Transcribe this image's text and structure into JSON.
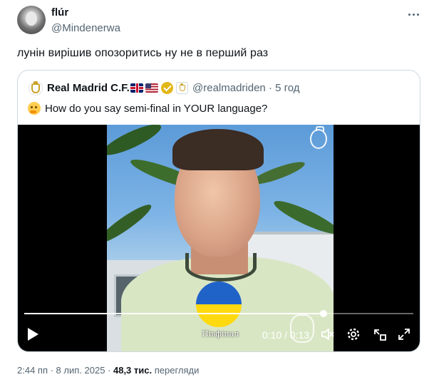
{
  "author": {
    "name": "flúr",
    "handle": "@Mindenerwa"
  },
  "tweet": {
    "text": "лунін вирішив опозоритись ну не в перший раз"
  },
  "quote": {
    "name": "Real Madrid C.F.",
    "handle": "@realmadriden · 5 год",
    "text": "How do you say semi-final in YOUR language?",
    "flags": [
      "uk-flag",
      "us-flag"
    ],
    "verified_color": "#e2b719"
  },
  "video": {
    "sticker_text": "Півфінал",
    "time": "0:10 / 0:13",
    "progress": 0.77,
    "controls": [
      "play",
      "volume",
      "settings",
      "picture-in-picture",
      "fullscreen"
    ]
  },
  "meta": {
    "timestamp": "2:44 пп · 8 лип. 2025 · ",
    "views": "48,3 тис.",
    "views_label": " перегляди"
  }
}
